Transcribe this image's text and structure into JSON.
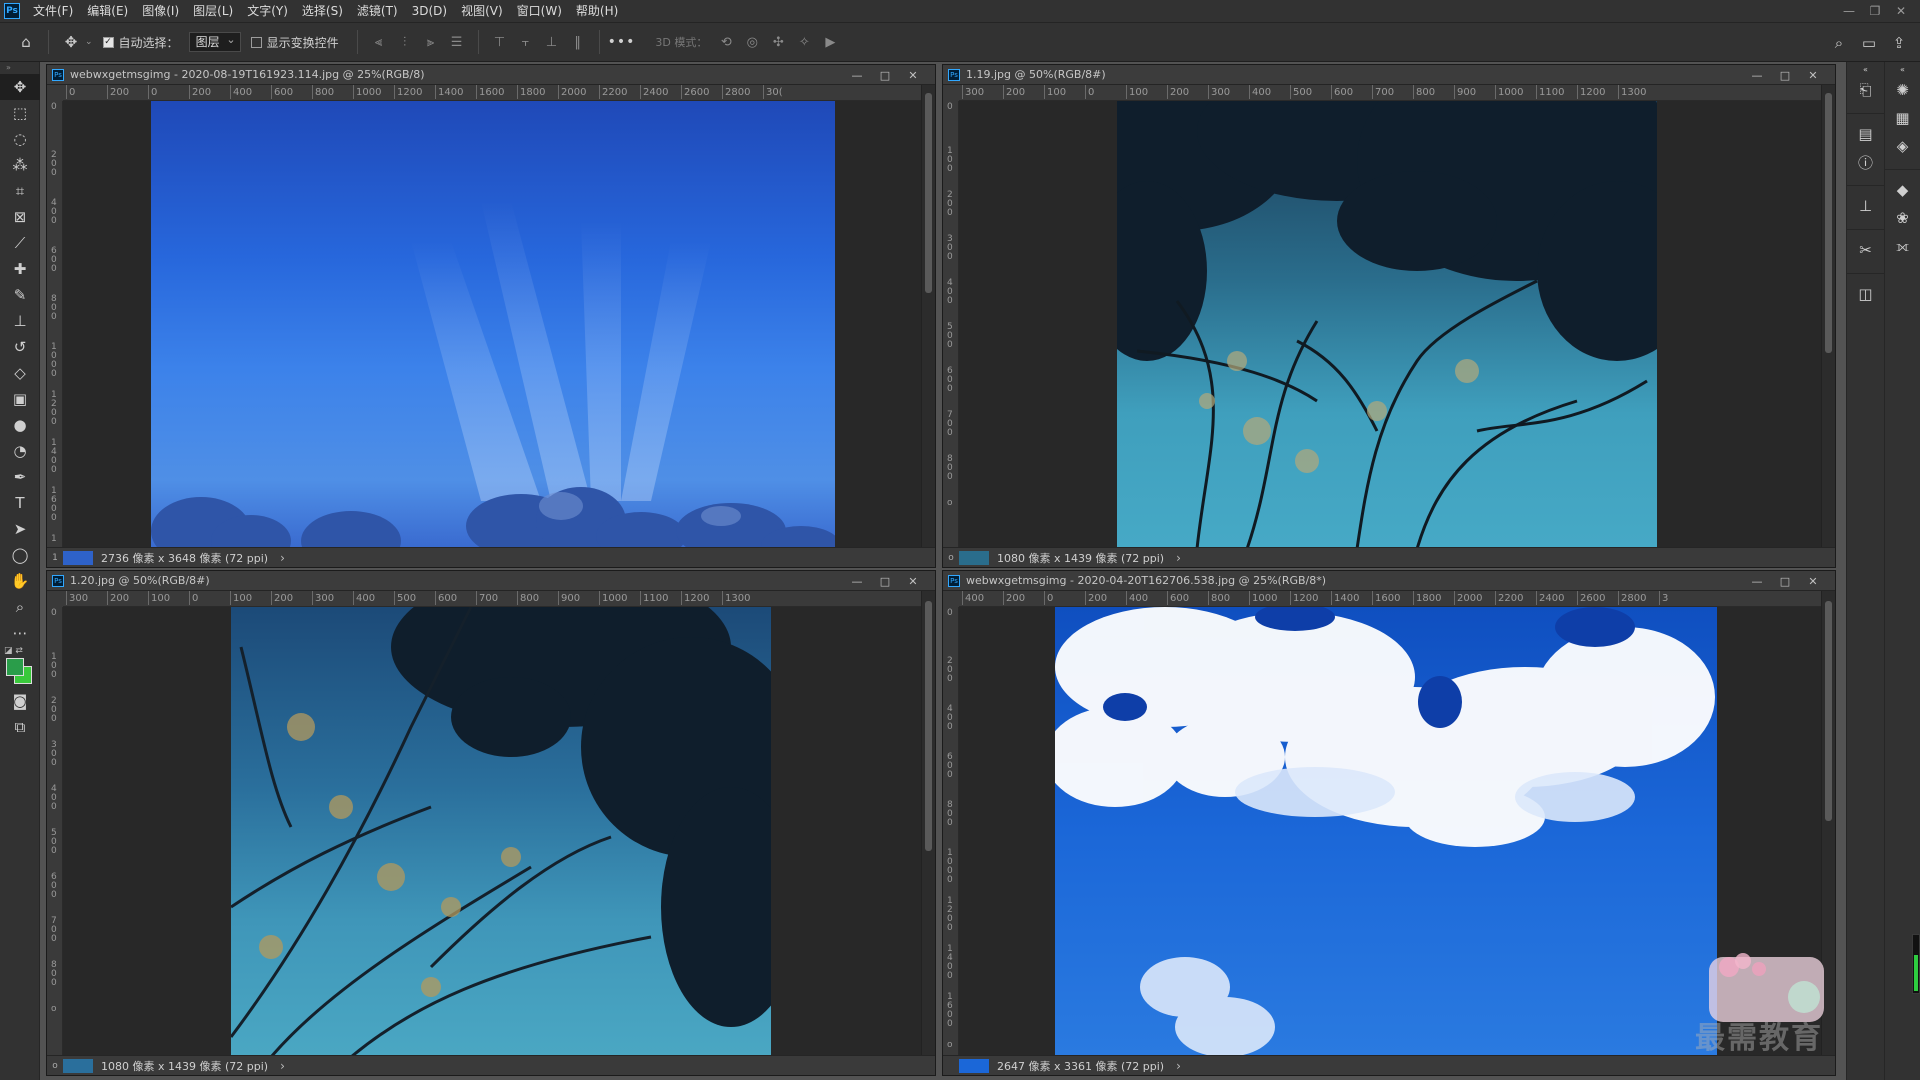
{
  "app": {
    "logo": "Ps",
    "menu": [
      "文件(F)",
      "编辑(E)",
      "图像(I)",
      "图层(L)",
      "文字(Y)",
      "选择(S)",
      "滤镜(T)",
      "3D(D)",
      "视图(V)",
      "窗口(W)",
      "帮助(H)"
    ],
    "window_controls": [
      "—",
      "❐",
      "✕"
    ]
  },
  "options": {
    "auto_select_label": "自动选择：",
    "auto_select_checked": true,
    "layer_select_value": "图层",
    "show_transform_label": "显示变换控件",
    "show_transform_checked": false,
    "more": "•••",
    "mode_3d_label": "3D 模式："
  },
  "docs": [
    {
      "title": "webwxgetmsgimg - 2020-08-19T161923.114.jpg @ 25%(RGB/8)",
      "status": "2736 像素 x 3648 像素 (72 ppi)",
      "ruler_h": [
        "0",
        "200",
        "0",
        "200",
        "400",
        "600",
        "800",
        "1000",
        "1200",
        "1400",
        "1600",
        "1800",
        "2000",
        "2200",
        "2400",
        "2600",
        "2800",
        "30("
      ],
      "ruler_v": [
        "0",
        "2 0 0",
        "4 0 0",
        "6 0 0",
        "8 0 0",
        "1 0 0 0",
        "1 2 0 0",
        "1 4 0 0",
        "1 6 0 0",
        "1"
      ]
    },
    {
      "title": "1.19.jpg @ 50%(RGB/8#)",
      "status": "1080 像素 x 1439 像素 (72 ppi)",
      "ruler_h": [
        "300",
        "200",
        "100",
        "0",
        "100",
        "200",
        "300",
        "400",
        "500",
        "600",
        "700",
        "800",
        "900",
        "1000",
        "1100",
        "1200",
        "1300"
      ],
      "ruler_v": [
        "0",
        "1 0 0",
        "2 0 0",
        "3 0 0",
        "4 0 0",
        "5 0 0",
        "6 0 0",
        "7 0 0",
        "8 0 0",
        "o"
      ]
    },
    {
      "title": "1.20.jpg @ 50%(RGB/8#)",
      "status": "1080 像素 x 1439 像素 (72 ppi)",
      "ruler_h": [
        "300",
        "200",
        "100",
        "0",
        "100",
        "200",
        "300",
        "400",
        "500",
        "600",
        "700",
        "800",
        "900",
        "1000",
        "1100",
        "1200",
        "1300"
      ],
      "ruler_v": [
        "0",
        "1 0 0",
        "2 0 0",
        "3 0 0",
        "4 0 0",
        "5 0 0",
        "6 0 0",
        "7 0 0",
        "8 0 0",
        "o"
      ]
    },
    {
      "title": "webwxgetmsgimg - 2020-04-20T162706.538.jpg @ 25%(RGB/8*)",
      "status": "2647 像素 x 3361 像素 (72 ppi)",
      "ruler_h": [
        "400",
        "200",
        "0",
        "200",
        "400",
        "600",
        "800",
        "1000",
        "1200",
        "1400",
        "1600",
        "1800",
        "2000",
        "2200",
        "2400",
        "2600",
        "2800",
        "3"
      ],
      "ruler_v": [
        "0",
        "2 0 0",
        "4 0 0",
        "6 0 0",
        "8 0 0",
        "1 0 0 0",
        "1 2 0 0",
        "1 4 0 0",
        "1 6 0 0",
        "o"
      ]
    }
  ],
  "doc_controls": [
    "—",
    "□",
    "✕"
  ],
  "status_arrow": "›",
  "watermark_text": "最需教育",
  "colors": {
    "foreground": "#2a9d4a",
    "background": "#39c93b",
    "accent": "#31a8ff"
  },
  "icons": {
    "toolbar": [
      "move-icon",
      "marquee-icon",
      "lasso-icon",
      "magic-wand-icon",
      "crop-icon",
      "frame-icon",
      "eyedropper-icon",
      "healing-icon",
      "brush-icon",
      "stamp-icon",
      "history-brush-icon",
      "eraser-icon",
      "gradient-icon",
      "blur-icon",
      "dodge-icon",
      "pen-icon",
      "type-icon",
      "path-select-icon",
      "ellipse-icon",
      "hand-icon",
      "zoom-icon",
      "more-tools-icon"
    ]
  }
}
